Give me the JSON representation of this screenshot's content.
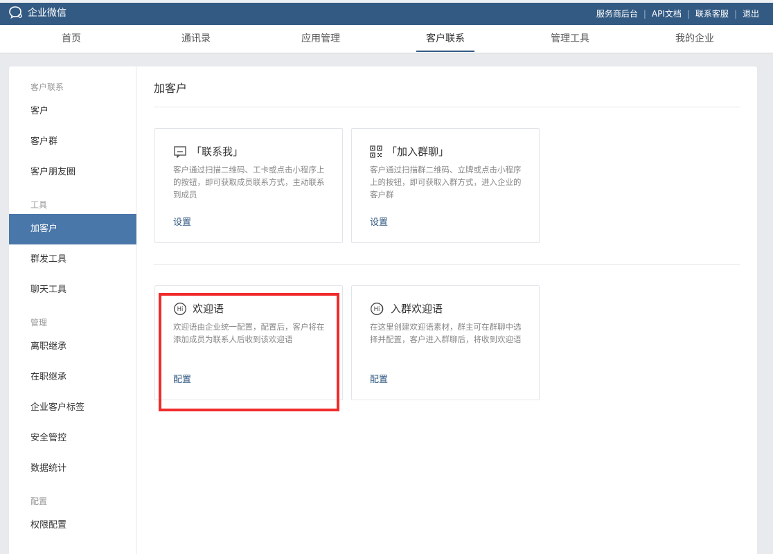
{
  "app": {
    "brand": "企业微信",
    "top_links": [
      "服务商后台",
      "API文档",
      "联系客服",
      "退出"
    ],
    "icons": {
      "brand": "chat-bubble-icon"
    }
  },
  "nav": {
    "tabs": [
      {
        "label": "首页"
      },
      {
        "label": "通讯录"
      },
      {
        "label": "应用管理"
      },
      {
        "label": "客户联系",
        "active": true
      },
      {
        "label": "管理工具"
      },
      {
        "label": "我的企业"
      }
    ]
  },
  "sidebar": {
    "groups": [
      {
        "title": "客户联系",
        "items": [
          "客户",
          "客户群",
          "客户朋友圈"
        ]
      },
      {
        "title": "工具",
        "items": [
          "加客户",
          "群发工具",
          "聊天工具"
        ]
      },
      {
        "title": "管理",
        "items": [
          "离职继承",
          "在职继承",
          "企业客户标签",
          "安全管控",
          "数据统计"
        ]
      },
      {
        "title": "配置",
        "items": [
          "权限配置"
        ]
      }
    ],
    "active_item": "加客户"
  },
  "main": {
    "title": "加客户",
    "cards": [
      {
        "icon": "contact-me-icon",
        "title": "「联系我」",
        "desc": "客户通过扫描二维码、工卡或点击小程序上的按钮，即可获取成员联系方式，主动联系到成员",
        "action": "设置"
      },
      {
        "icon": "qr-code-icon",
        "title": "「加入群聊」",
        "desc": "客户通过扫描群二维码、立牌或点击小程序上的按钮，即可获取入群方式，进入企业的客户群",
        "action": "设置"
      },
      {
        "icon": "hi-welcome-icon",
        "title": "欢迎语",
        "desc": "欢迎语由企业统一配置，配置后，客户将在添加成员为联系人后收到该欢迎语",
        "action": "配置"
      },
      {
        "icon": "group-hi-welcome-icon",
        "title": "入群欢迎语",
        "desc": "在这里创建欢迎语素材，群主可在群聊中选择并配置，客户进入群聊后，将收到欢迎语",
        "action": "配置"
      }
    ]
  },
  "colors": {
    "topbar": "#335a83",
    "active_sidebar": "#4a77a9",
    "highlight": "#f02b2b",
    "link": "#335a83"
  }
}
